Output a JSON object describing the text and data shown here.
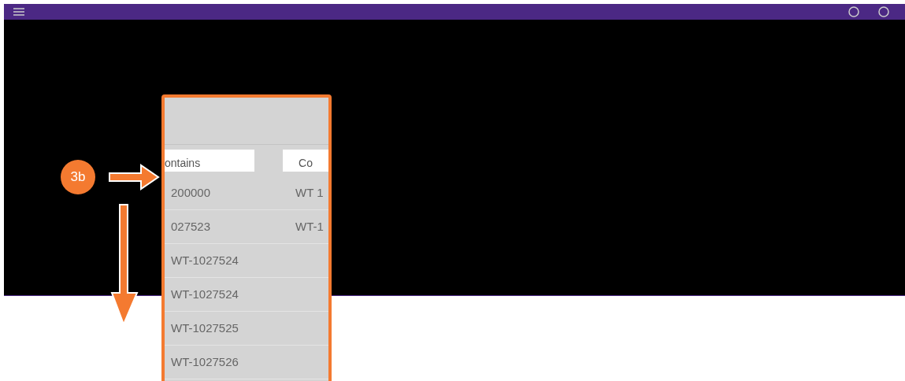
{
  "callout": {
    "badge": "3b"
  },
  "table": {
    "filters": [
      "ontains",
      "Co"
    ],
    "rows": [
      {
        "cells": [
          "200000",
          "WT 1"
        ]
      },
      {
        "cells": [
          "027523",
          "WT-1"
        ]
      },
      {
        "cells": [
          "WT-1027524"
        ]
      },
      {
        "cells": [
          "WT-1027524"
        ]
      },
      {
        "cells": [
          "WT-1027525"
        ]
      },
      {
        "cells": [
          "WT-1027526"
        ]
      }
    ]
  }
}
